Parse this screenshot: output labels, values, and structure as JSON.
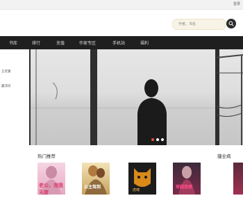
{
  "topbar": {
    "link": "登录"
  },
  "search": {
    "placeholder": "作者、书名",
    "icon": "search-icon"
  },
  "nav": {
    "items": [
      {
        "label": "书库"
      },
      {
        "label": "排行"
      },
      {
        "label": "充值"
      },
      {
        "label": "作家专区"
      },
      {
        "label": "手机站"
      },
      {
        "label": "福利"
      }
    ]
  },
  "sidebar": {
    "items": [
      {
        "label": "言老婆"
      },
      {
        "label": "霸凉凤"
      }
    ]
  },
  "banner": {
    "slides": 3,
    "active_slide": 1
  },
  "sections": {
    "hot": "热门推荐",
    "complete": "蕴全病"
  },
  "books": [
    {
      "title": "老公，宠我无度"
    },
    {
      "title": "公主驾到"
    },
    {
      "title": "虎啸"
    },
    {
      "title": ""
    },
    {
      "title": "穿越原唐"
    },
    {
      "title": ""
    }
  ],
  "colors": {
    "nav_bg": "#1f1f1f",
    "accent": "#e0533c"
  }
}
